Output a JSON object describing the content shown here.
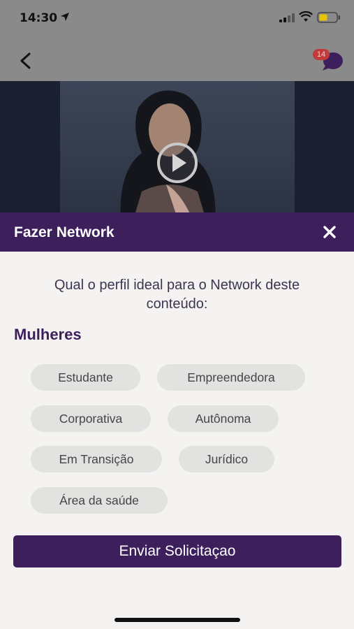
{
  "status_bar": {
    "time": "14:30"
  },
  "header": {
    "chat_badge_count": "14"
  },
  "modal": {
    "title": "Fazer Network",
    "question": "Qual o perfil ideal para o Network deste conteúdo:",
    "section_label": "Mulheres",
    "chips": [
      "Estudante",
      "Empreendedora",
      "Corporativa",
      "Autônoma",
      "Em Transição",
      "Jurídico",
      "Área da saúde"
    ],
    "submit_label": "Enviar Solicitaçao"
  },
  "colors": {
    "brand_purple": "#3d1f5c",
    "chip_bg": "#e2e2e0",
    "badge_red": "#c13b3b"
  }
}
